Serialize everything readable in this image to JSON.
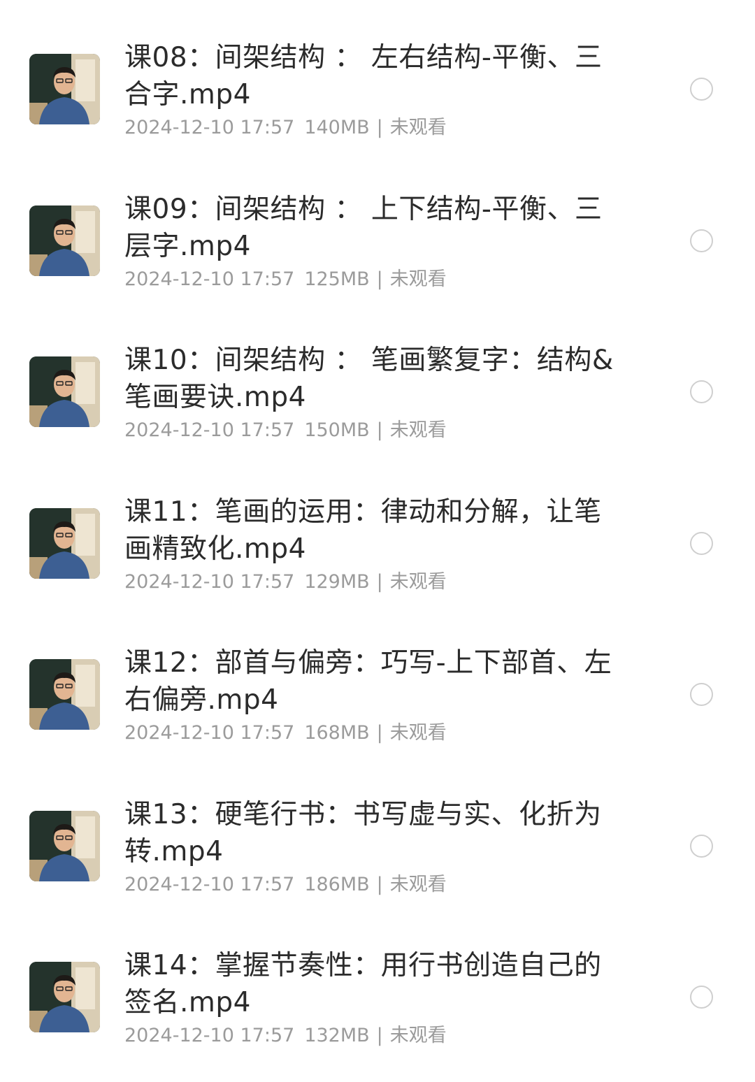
{
  "colors": {
    "title_text": "#2b2b2b",
    "meta_text": "#9b9b9b",
    "radio_border": "#cfcfcf",
    "background": "#ffffff"
  },
  "files": [
    {
      "title": "课08：间架结构 ： 左右结构-平衡、三合字.mp4",
      "date": "2024-12-10 17:57",
      "size": "140MB",
      "separator": "|",
      "status": "未观看",
      "thumbnail_icon": "video-thumbnail"
    },
    {
      "title": "课09：间架结构 ： 上下结构-平衡、三层字.mp4",
      "date": "2024-12-10 17:57",
      "size": "125MB",
      "separator": "|",
      "status": "未观看",
      "thumbnail_icon": "video-thumbnail"
    },
    {
      "title": "课10：间架结构 ： 笔画繁复字：结构&笔画要诀.mp4",
      "date": "2024-12-10 17:57",
      "size": "150MB",
      "separator": "|",
      "status": "未观看",
      "thumbnail_icon": "video-thumbnail"
    },
    {
      "title": "课11：笔画的运用：律动和分解，让笔画精致化.mp4",
      "date": "2024-12-10 17:57",
      "size": "129MB",
      "separator": "|",
      "status": "未观看",
      "thumbnail_icon": "video-thumbnail"
    },
    {
      "title": "课12：部首与偏旁：巧写-上下部首、左右偏旁.mp4",
      "date": "2024-12-10 17:57",
      "size": "168MB",
      "separator": "|",
      "status": "未观看",
      "thumbnail_icon": "video-thumbnail"
    },
    {
      "title": "课13：硬笔行书：书写虚与实、化折为转.mp4",
      "date": "2024-12-10 17:57",
      "size": "186MB",
      "separator": "|",
      "status": "未观看",
      "thumbnail_icon": "video-thumbnail"
    },
    {
      "title": "课14：掌握节奏性：用行书创造自己的签名.mp4",
      "date": "2024-12-10 17:57",
      "size": "132MB",
      "separator": "|",
      "status": "未观看",
      "thumbnail_icon": "video-thumbnail"
    }
  ]
}
